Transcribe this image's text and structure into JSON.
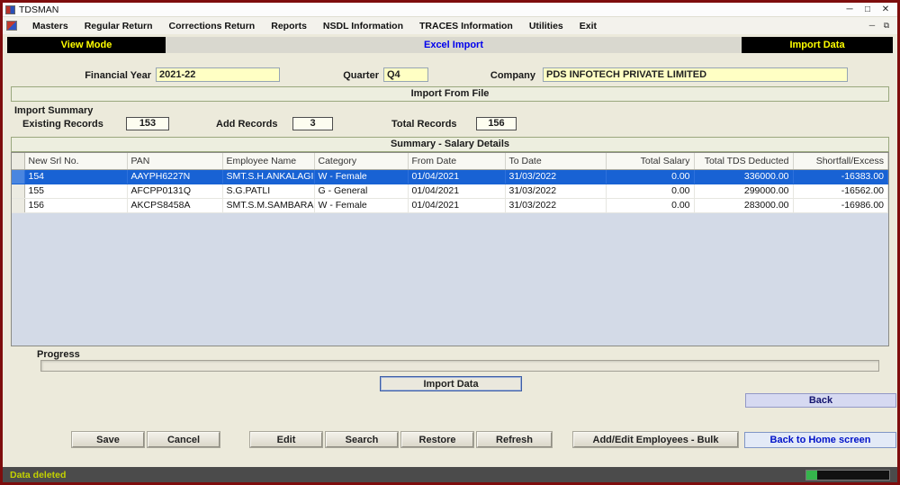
{
  "titlebar": {
    "title": "TDSMAN"
  },
  "menubar": {
    "items": [
      "Masters",
      "Regular Return",
      "Corrections Return",
      "Reports",
      "NSDL Information",
      "TRACES Information",
      "Utilities",
      "Exit"
    ]
  },
  "modebar": {
    "left": "View Mode",
    "center": "Excel Import",
    "right": "Import Data"
  },
  "form": {
    "financial_year_label": "Financial Year",
    "financial_year": "2021-22",
    "quarter_label": "Quarter",
    "quarter": "Q4",
    "company_label": "Company",
    "company": "PDS INFOTECH PRIVATE LIMITED"
  },
  "sections": {
    "import_from_file": "Import From File",
    "summary_title": "Summary - Salary Details"
  },
  "import_summary": {
    "heading": "Import Summary",
    "existing_label": "Existing Records",
    "existing_value": "153",
    "add_label": "Add Records",
    "add_value": "3",
    "total_label": "Total Records",
    "total_value": "156"
  },
  "table": {
    "columns": [
      "New Srl No.",
      "PAN",
      "Employee Name",
      "Category",
      "From Date",
      "To Date",
      "Total Salary",
      "Total TDS Deducted",
      "Shortfall/Excess"
    ],
    "selected_row_index": 0,
    "rows": [
      [
        "154",
        "AAYPH6227N",
        "SMT.S.H.ANKALAGI",
        "W - Female",
        "01/04/2021",
        "31/03/2022",
        "0.00",
        "336000.00",
        "-16383.00"
      ],
      [
        "155",
        "AFCPP0131Q",
        "S.G.PATLI",
        "G - General",
        "01/04/2021",
        "31/03/2022",
        "0.00",
        "299000.00",
        "-16562.00"
      ],
      [
        "156",
        "AKCPS8458A",
        "SMT.S.M.SAMBARA...",
        "W - Female",
        "01/04/2021",
        "31/03/2022",
        "0.00",
        "283000.00",
        "-16986.00"
      ]
    ]
  },
  "progress": {
    "label": "Progress"
  },
  "buttons": {
    "import_data": "Import Data",
    "back": "Back",
    "save": "Save",
    "cancel": "Cancel",
    "edit": "Edit",
    "search": "Search",
    "restore": "Restore",
    "refresh": "Refresh",
    "add_edit_bulk": "Add/Edit Employees - Bulk",
    "back_home": "Back to Home screen"
  },
  "statusbar": {
    "message": "Data deleted"
  },
  "colors": {
    "selected_row": "#1862d4",
    "mode_text_yellow": "#ffff00",
    "mode_text_blue": "#0000ee",
    "status_text": "#c3d200",
    "input_bg": "#ffffc4"
  }
}
